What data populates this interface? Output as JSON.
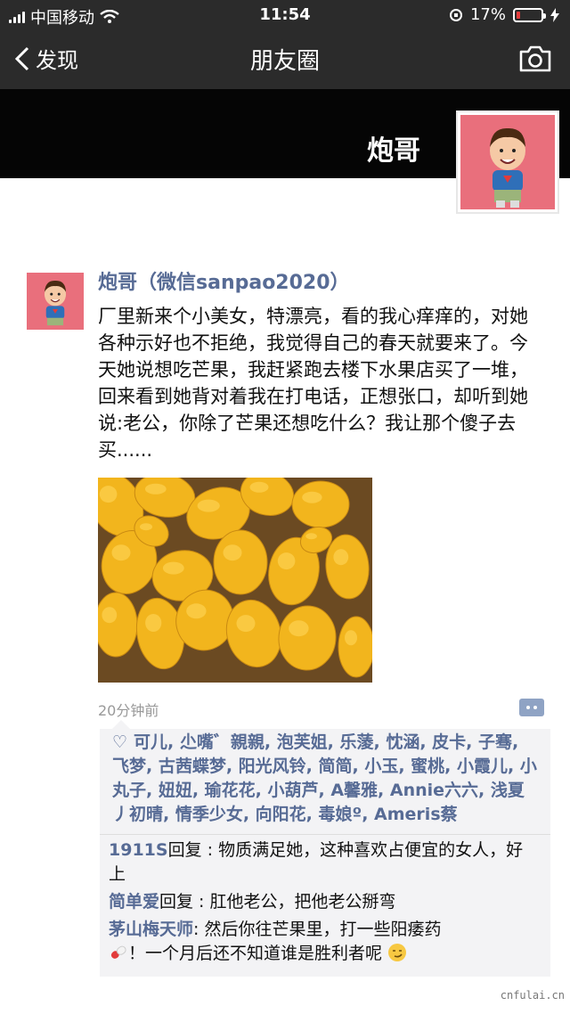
{
  "status_bar": {
    "carrier": "中国移动",
    "time": "11:54",
    "battery": "17%",
    "battery_level": 0.17
  },
  "nav": {
    "back_label": "发现",
    "title": "朋友圈"
  },
  "cover": {
    "name": "炮哥"
  },
  "post": {
    "author": "炮哥（微信sanpao2020）",
    "text": "厂里新来个小美女，特漂亮，看的我心痒痒的，对她各种示好也不拒绝，我觉得自己的春天就要来了。今天她说想吃芒果，我赶紧跑去楼下水果店买了一堆，回来看到她背对着我在打电话，正想张口，却听到她说:老公，你除了芒果还想吃什么？我让那个傻子去买......",
    "time": "20分钟前",
    "likes": "可儿, 尐嘴゛親親, 泡芙姐, 乐蔆, 忱涵, 皮卡, 子骞, 飞梦, 古茜蝶梦, 阳光风铃, 简简, 小玉, 蜜桃, 小霞儿, 小丸子, 妞妞, 瑜花花, 小葫芦, A馨雅, Annie六六, 浅夏丿初晴, 情季少女, 向阳花, 毒娘º, Ameris蔡",
    "comments": [
      {
        "user": "1911S",
        "verb": "回复 : ",
        "text": "物质满足她，这种喜欢占便宜的女人，好上"
      },
      {
        "user": "简单爱",
        "verb": "回复 : ",
        "text": "肛他老公，把他老公掰弯"
      },
      {
        "user": "茅山梅天师",
        "verb": ": ",
        "text": "然后你往芒果里，打一些阳痿药",
        "text2": "！一个月后还不知道谁是胜利者呢"
      }
    ]
  },
  "watermark": "cnfulai.cn",
  "colors": {
    "link": "#576b95",
    "avatar_bg": "#e96f7c",
    "mango": "#f2b51d"
  }
}
